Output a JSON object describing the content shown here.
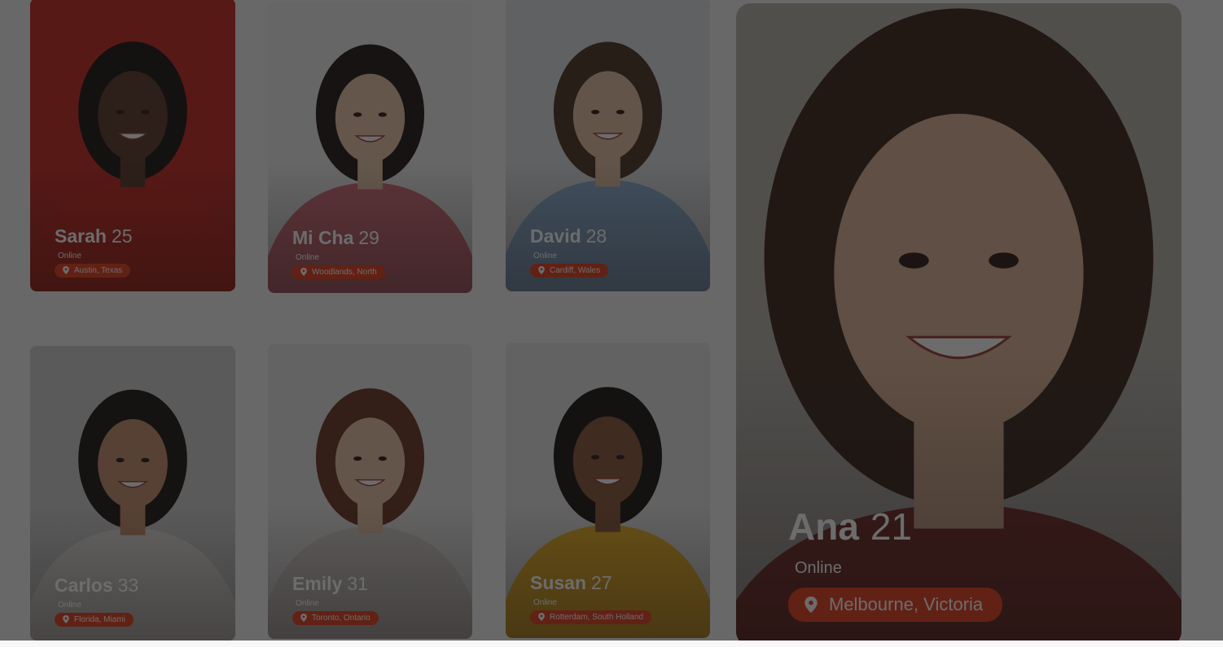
{
  "profiles": [
    {
      "name": "Sarah",
      "age": "25",
      "status": "Online",
      "location": "Austin, Texas",
      "bg": "#c8261f",
      "skin": "#5a3526",
      "hair": "#1a1210",
      "shirt": "#d0251c"
    },
    {
      "name": "Mi Cha",
      "age": "29",
      "status": "Online",
      "location": "Woodlands, North",
      "bg": "#efefef",
      "skin": "#e9c6a8",
      "hair": "#1e1613",
      "shirt": "#d76b78"
    },
    {
      "name": "David",
      "age": "28",
      "status": "Online",
      "location": "Cardiff, Wales",
      "bg": "#dfe3e6",
      "skin": "#e6c1a3",
      "hair": "#4a3322",
      "shirt": "#8fb4d9"
    },
    {
      "name": "Carlos",
      "age": "33",
      "status": "Online",
      "location": "Florida, Miami",
      "bg": "#cfcfcf",
      "skin": "#c98f6f",
      "hair": "#1b1512",
      "shirt": "#e9e5e1"
    },
    {
      "name": "Emily",
      "age": "31",
      "status": "Online",
      "location": "Toronto, Ontario",
      "bg": "#e9e7e6",
      "skin": "#eac3a6",
      "hair": "#6a3521",
      "shirt": "#d8d2cd"
    },
    {
      "name": "Susan",
      "age": "27",
      "status": "Online",
      "location": "Rotterdam, South Holland",
      "bg": "#e4e4e4",
      "skin": "#8a5538",
      "hair": "#1a1412",
      "shirt": "#f0b21e"
    }
  ],
  "featured": {
    "name": "Ana",
    "age": "21",
    "status": "Online",
    "location": "Melbourne, Victoria",
    "bg": "#b7b2ac",
    "skin": "#ddb296",
    "hair": "#3b241a",
    "shirt": "#7a2a24"
  },
  "icons": {
    "location": "location-pin-icon"
  }
}
